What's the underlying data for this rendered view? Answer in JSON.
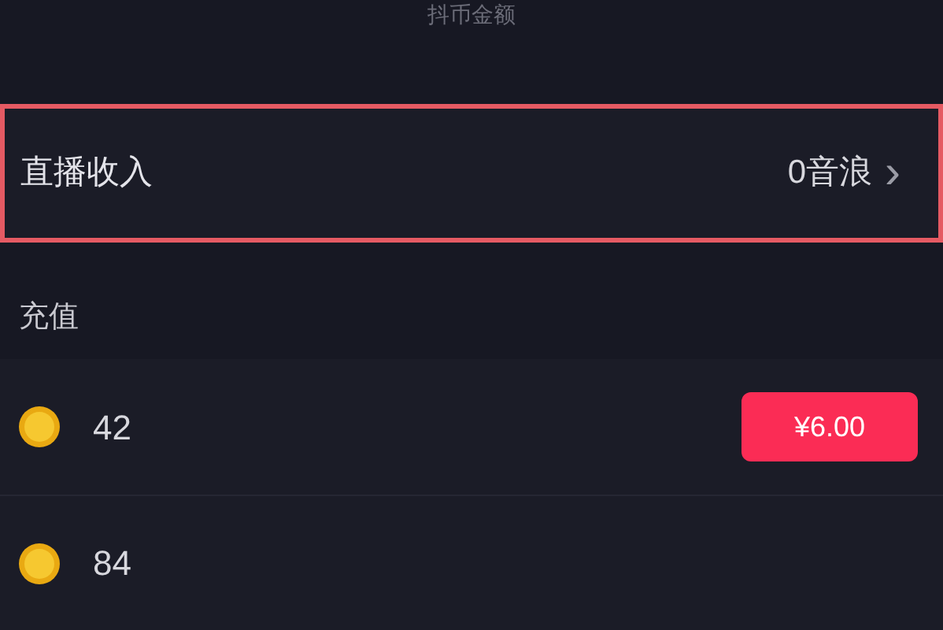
{
  "header": {
    "title": "抖币金额"
  },
  "income": {
    "label": "直播收入",
    "value": "0音浪",
    "chevron": "›",
    "highlighted": true
  },
  "recharge": {
    "title": "充值",
    "packages": [
      {
        "amount": "42",
        "price": "¥6.00"
      },
      {
        "amount": "84"
      }
    ]
  }
}
